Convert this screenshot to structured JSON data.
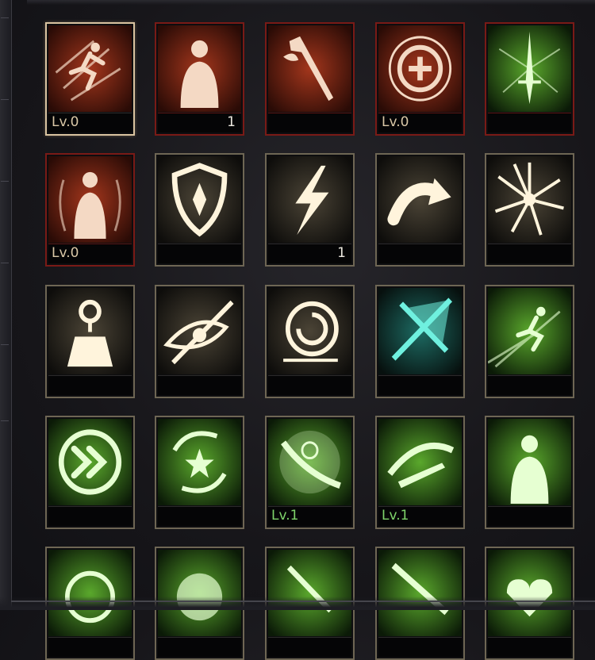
{
  "colors": {
    "slot_border": "#6e6654",
    "slot_border_red": "#7a1a16",
    "slot_border_selected": "#d9c3a0",
    "level_text": "#d9c7a6",
    "level_text_green": "#7fd36a",
    "count_text": "#ece8df"
  },
  "slots": [
    {
      "name": "sprint-dash-skill",
      "icon": "sprinting-figure-icon",
      "theme": "red-fire",
      "border": "selected",
      "level": "Lv.0",
      "count": ""
    },
    {
      "name": "crowd-figure-skill",
      "icon": "standing-figure-crowd-icon",
      "theme": "red-fire",
      "border": "red",
      "level": "",
      "count": "1"
    },
    {
      "name": "flaming-dagger-skill",
      "icon": "flaming-dagger-icon",
      "theme": "red-fire",
      "border": "red",
      "level": "",
      "count": ""
    },
    {
      "name": "healing-rune-skill",
      "icon": "rune-circle-cross-icon",
      "theme": "red-fire",
      "border": "red",
      "level": "Lv.0",
      "count": ""
    },
    {
      "name": "green-sword-burst-skill",
      "icon": "sword-burst-icon",
      "theme": "green",
      "border": "red",
      "level": "",
      "count": ""
    },
    {
      "name": "aura-figure-skill",
      "icon": "aura-figure-icon",
      "theme": "red-fire",
      "border": "red",
      "level": "Lv.0",
      "count": ""
    },
    {
      "name": "shield-skill",
      "icon": "shield-icon",
      "theme": "light",
      "border": "normal",
      "level": "",
      "count": ""
    },
    {
      "name": "lightning-skill",
      "icon": "lightning-bolt-icon",
      "theme": "light",
      "border": "normal",
      "level": "",
      "count": "1"
    },
    {
      "name": "curved-arrow-skill",
      "icon": "curved-arrow-icon",
      "theme": "light",
      "border": "normal",
      "level": "",
      "count": ""
    },
    {
      "name": "star-burst-skill",
      "icon": "star-burst-icon",
      "theme": "light",
      "border": "normal",
      "level": "",
      "count": ""
    },
    {
      "name": "location-pin-skill",
      "icon": "map-pin-sparkle-icon",
      "theme": "light",
      "border": "normal",
      "level": "",
      "count": ""
    },
    {
      "name": "eye-slash-skill",
      "icon": "eye-slash-icon",
      "theme": "light",
      "border": "normal",
      "level": "",
      "count": ""
    },
    {
      "name": "spiked-spiral-skill",
      "icon": "spiked-spiral-icon",
      "theme": "light",
      "border": "normal",
      "level": "",
      "count": ""
    },
    {
      "name": "teal-blade-skill",
      "icon": "teal-crossed-blade-icon",
      "theme": "teal",
      "border": "normal",
      "level": "",
      "count": ""
    },
    {
      "name": "green-sprint-skill",
      "icon": "green-sprinting-figure-icon",
      "theme": "green",
      "border": "normal",
      "level": "",
      "count": ""
    },
    {
      "name": "fast-forward-skill",
      "icon": "double-chevron-icon",
      "theme": "green",
      "border": "normal",
      "level": "",
      "count": ""
    },
    {
      "name": "rune-star-swirl-skill",
      "icon": "rune-star-swirl-icon",
      "theme": "green",
      "border": "normal",
      "level": "",
      "count": ""
    },
    {
      "name": "rune-slash-skill",
      "icon": "rune-slash-icon",
      "theme": "green",
      "border": "normal",
      "level": "Lv.1",
      "count": ""
    },
    {
      "name": "green-dagger-swirl-skill",
      "icon": "dagger-swirl-icon",
      "theme": "green",
      "border": "normal",
      "level": "Lv.1",
      "count": ""
    },
    {
      "name": "green-crowd-figure-skill",
      "icon": "green-standing-figure-icon",
      "theme": "green",
      "border": "normal",
      "level": "",
      "count": ""
    },
    {
      "name": "row5-skill-1",
      "icon": "green-emblem-icon",
      "theme": "green",
      "border": "normal",
      "level": "",
      "count": ""
    },
    {
      "name": "row5-skill-2",
      "icon": "green-crest-icon",
      "theme": "green",
      "border": "normal",
      "level": "",
      "count": ""
    },
    {
      "name": "row5-skill-3",
      "icon": "green-dagger-icon",
      "theme": "green",
      "border": "normal",
      "level": "",
      "count": ""
    },
    {
      "name": "row5-skill-4",
      "icon": "green-blade-icon",
      "theme": "green",
      "border": "normal",
      "level": "",
      "count": ""
    },
    {
      "name": "row5-skill-5",
      "icon": "green-heart-icon",
      "theme": "green",
      "border": "normal",
      "level": "",
      "count": ""
    }
  ]
}
